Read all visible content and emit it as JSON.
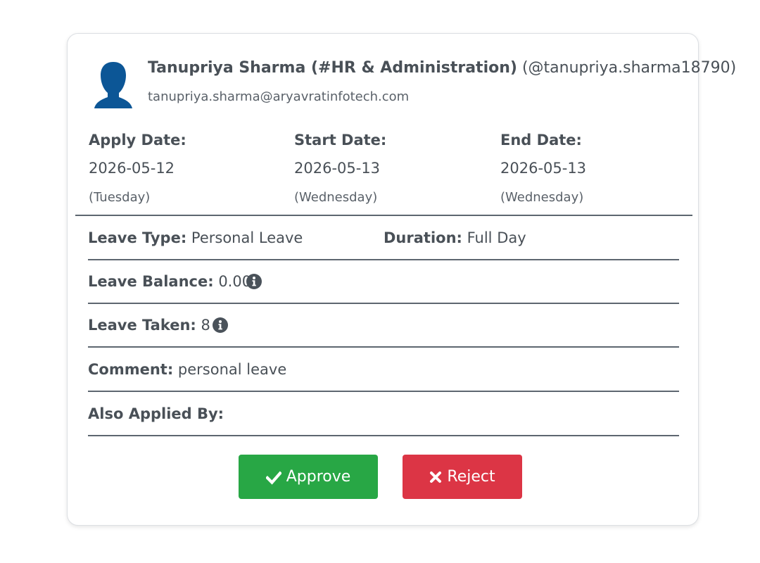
{
  "user": {
    "name_dept": "Tanupriya Sharma (#HR & Administration)",
    "handle": "(@tanupriya.sharma18790)",
    "email": "tanupriya.sharma@aryavratinfotech.com",
    "avatar_icon": "user-silhouette-icon"
  },
  "dates": {
    "apply": {
      "label": "Apply Date:",
      "value": "2026-05-12",
      "day": "(Tuesday)"
    },
    "start": {
      "label": "Start Date:",
      "value": "2026-05-13",
      "day": "(Wednesday)"
    },
    "end": {
      "label": "End Date:",
      "value": "2026-05-13",
      "day": "(Wednesday)"
    }
  },
  "details": {
    "leave_type": {
      "label": "Leave Type:",
      "value": "Personal Leave"
    },
    "duration": {
      "label": "Duration:",
      "value": "Full Day"
    },
    "leave_balance": {
      "label": "Leave Balance:",
      "value": "0.00"
    },
    "leave_taken": {
      "label": "Leave Taken:",
      "value": "8"
    },
    "comment": {
      "label": "Comment:",
      "value": "personal leave"
    },
    "also_applied_by": {
      "label": "Also Applied By:",
      "value": ""
    }
  },
  "actions": {
    "approve_label": "Approve",
    "reject_label": "Reject",
    "approve_color": "#28a745",
    "reject_color": "#dc3545"
  },
  "colors": {
    "avatar": "#0c5696",
    "text": "#495057",
    "info_icon": "#4a525a"
  }
}
